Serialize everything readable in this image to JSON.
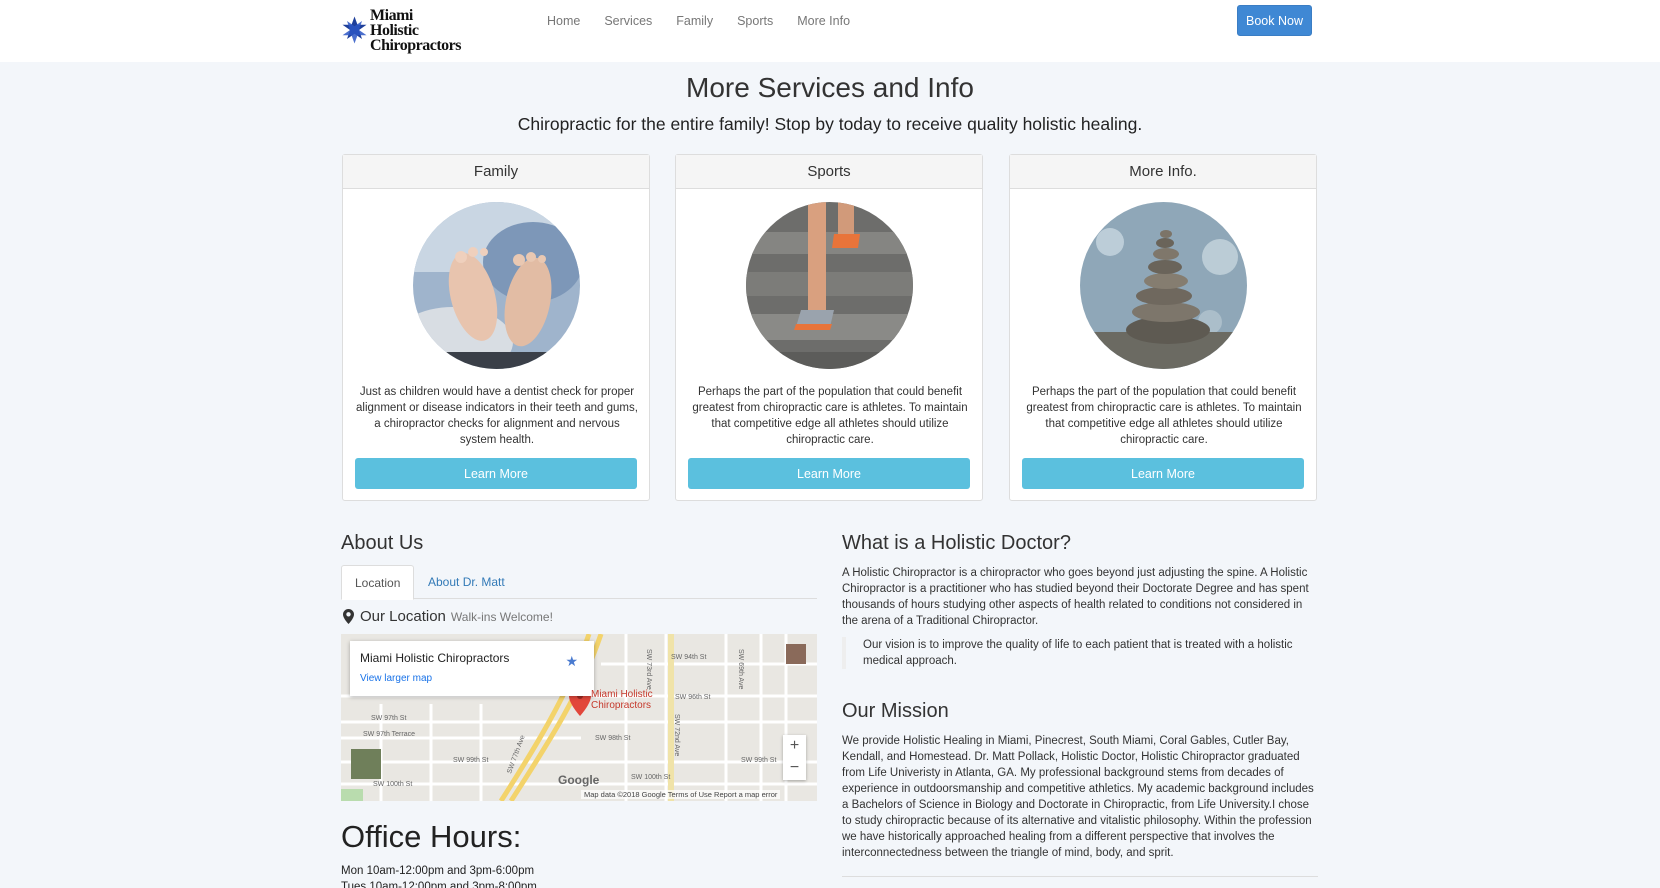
{
  "nav": {
    "logo_line1": "Miami Holistic",
    "logo_line2": "Chiropractors",
    "links": [
      "Home",
      "Services",
      "Family",
      "Sports",
      "More Info"
    ],
    "book_button": "Book Now"
  },
  "hero": {
    "title": "More Services and Info",
    "subtitle": "Chiropractic for the entire family! Stop by today to receive quality holistic healing."
  },
  "cards": [
    {
      "title": "Family",
      "image": "baby-feet",
      "text": "Just as children would have a dentist check for proper alignment or disease indicators in their teeth and gums, a chiropractor checks for alignment and nervous system health.",
      "button": "Learn More"
    },
    {
      "title": "Sports",
      "image": "runner-stairs",
      "text": "Perhaps the part of the population that could benefit greatest from chiropractic care is athletes. To maintain that competitive edge all athletes should utilize chiropractic care.",
      "button": "Learn More"
    },
    {
      "title": "More Info.",
      "image": "stacked-stones",
      "text": "Perhaps the part of the population that could benefit greatest from chiropractic care is athletes. To maintain that competitive edge all athletes should utilize chiropractic care.",
      "button": "Learn More"
    }
  ],
  "about": {
    "heading": "About Us",
    "tabs": [
      "Location",
      "About Dr. Matt"
    ],
    "location_label": "Our Location",
    "location_note": "Walk-ins Welcome!",
    "map": {
      "place_name": "Miami Holistic Chiropractors",
      "view_larger": "View larger map",
      "pin_label_1": "Miami Holistic",
      "pin_label_2": "Chiropractors",
      "streets": [
        "SW 94th St",
        "SW 96th St",
        "SW 97th St",
        "SW 97th Terrace",
        "SW 98th St",
        "SW 99th St",
        "SW 100th St",
        "SW 72nd Ave",
        "SW 73rd Ave",
        "SW 69th Ave",
        "SW 77th Ave"
      ],
      "zoom_in": "+",
      "zoom_out": "−",
      "google": "Google",
      "footer": "Map data ©2018 Google    Terms of Use    Report a map error"
    }
  },
  "hours": {
    "heading": "Office Hours:",
    "lines": [
      "Mon 10am-12:00pm and 3pm-6:00pm",
      "Tues 10am-12:00pm and 3pm-8:00pm"
    ]
  },
  "holistic": {
    "heading": "What is a Holistic Doctor?",
    "body": "A Holistic Chiropractor is a chiropractor who goes beyond just adjusting the spine. A Holistic Chiropractor is a practitioner who has studied beyond their Doctorate Degree and has spent thousands of hours studying other aspects of health related to conditions not considered in the arena of a Traditional Chiropractor.",
    "quote": "Our vision is to improve the quality of life to each patient that is treated with a holistic medical approach."
  },
  "mission": {
    "heading": "Our Mission",
    "body": "We provide Holistic Healing in Miami, Pinecrest, South Miami, Coral Gables, Cutler Bay, Kendall, and Homestead. Dr. Matt Pollack, Holistic Doctor, Holistic Chiropractor graduated from Life Univeristy in Atlanta, GA. My professional background stems from decades of experience in outdoorsmanship and competitive athletics. My academic background includes a Bachelors of Science in Biology and Doctorate in Chiropractic, from Life University.I chose to study chiropractic because of its alternative and vitalistic philosophy. Within the profession we have historically approached healing from a different perspective that involves the interconnectedness between the triangle of mind, body, and sprit."
  },
  "colors": {
    "primary": "#3f88d4",
    "info": "#5bc0de",
    "background": "#f3f6fa",
    "link": "#337ab7"
  }
}
